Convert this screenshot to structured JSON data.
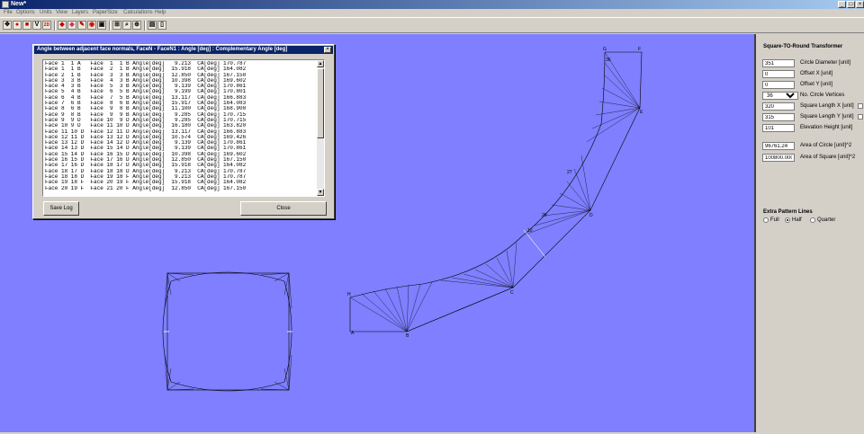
{
  "window": {
    "title": "New*",
    "minimize": "_",
    "maximize": "□",
    "close": "×"
  },
  "menu": [
    "File",
    "Options",
    "Units",
    "View",
    "Layers",
    "PaperSize",
    "Calculations",
    "Help"
  ],
  "toolbar": {
    "buttons": [
      {
        "name": "move-icon",
        "glyph": "✥"
      },
      {
        "name": "ring-icon",
        "glyph": "●"
      },
      {
        "name": "box-icon",
        "glyph": "■"
      },
      {
        "name": "v-icon",
        "glyph": "V"
      },
      {
        "name": "2d-icon",
        "glyph": "2D"
      },
      {
        "name": "shape-red-icon",
        "glyph": "◆"
      },
      {
        "name": "shape-pink-icon",
        "glyph": "◆"
      },
      {
        "name": "pen-icon",
        "glyph": "✎"
      },
      {
        "name": "stamp-icon",
        "glyph": "◉"
      },
      {
        "name": "print-icon",
        "glyph": "▣"
      },
      {
        "name": "measure-icon",
        "glyph": "⊞"
      },
      {
        "name": "zoom-icon",
        "glyph": "⌕"
      },
      {
        "name": "pan-icon",
        "glyph": "⊕"
      },
      {
        "name": "printer-icon",
        "glyph": "▤"
      },
      {
        "name": "page-icon",
        "glyph": "▯"
      }
    ]
  },
  "panel": {
    "title": "Square-TO-Round Transformer",
    "rows": [
      {
        "value": "351",
        "label": "Circle Diameter [unit]"
      },
      {
        "value": "0",
        "label": "Offset X [unit]"
      },
      {
        "value": "0",
        "label": "Offset Y [unit]"
      },
      {
        "value": "36",
        "label": "No. Circle Vertices",
        "type": "select"
      },
      {
        "value": "320",
        "label": "Square Length X [unit]",
        "check": true
      },
      {
        "value": "315",
        "label": "Square Length Y [unit]",
        "check": true
      },
      {
        "value": "101",
        "label": "Elevation Height [unit]"
      }
    ],
    "areas": [
      {
        "value": "96761.24",
        "label": "Area of Circle [unit]^2"
      },
      {
        "value": "100800.000",
        "label": "Area of Square [unit]^2"
      }
    ],
    "extra_title": "Extra Pattern Lines",
    "radios": [
      {
        "label": "Full",
        "selected": false
      },
      {
        "label": "Half",
        "selected": true
      },
      {
        "label": "Quarter",
        "selected": false
      }
    ]
  },
  "dialog": {
    "title": "Angle between adjacent face normals, FaceN - FaceN1 : Angle [deg] : Complementary Angle [deg]",
    "close_x": "×",
    "lines": [
      "Face 1  1 A   Face  1  1 B Angle[deg]   9.213  CA[deg] 170.787",
      "Face 1  1 B   Face  2  1 B Angle[deg]  15.918  CA[deg] 164.082",
      "Face 2  1 B   Face  3  3 B Angle[deg]  12.850  CA[deg] 167.150",
      "Face 3  3 B   Face  4  3 B Angle[deg]  10.398  CA[deg] 169.602",
      "Face 4  3 B   Face  5  3 B Angle[deg]   9.139  CA[deg] 170.861",
      "Face 5  4 B   Face  6  5 B Angle[deg]   9.199  CA[deg] 170.801",
      "Face 6  4 B   Face  7  5 B Angle[deg]  13.117  CA[deg] 166.883",
      "Face 7  6 B   Face  8  6 B Angle[deg]  15.917  CA[deg] 164.083",
      "Face 8  6 B   Face  9  8 B Angle[deg]  11.100  CA[deg] 168.900",
      "Face 9  8 B   Face  9  9 B Angle[deg]   9.285  CA[deg] 170.715",
      "Face 9  9 D   Face 10  9 D Angle[deg]   9.285  CA[deg] 170.715",
      "Face 10 9 D   Face 11 10 D Angle[deg]  16.180  CA[deg] 163.820",
      "Face 11 10 D  Face 12 11 D Angle[deg]  13.117  CA[deg] 166.883",
      "Face 12 11 D  Face 13 12 D Angle[deg]  10.574  CA[deg] 169.426",
      "Face 13 12 D  Face 14 12 D Angle[deg]   9.139  CA[deg] 170.861",
      "Face 14 13 D  Face 15 14 D Angle[deg]   9.139  CA[deg] 170.861",
      "Face 15 14 D  Face 16 15 D Angle[deg]  10.398  CA[deg] 169.602",
      "Face 16 15 D  Face 17 16 D Angle[deg]  12.850  CA[deg] 167.150",
      "Face 17 16 D  Face 18 17 D Angle[deg]  15.918  CA[deg] 164.082",
      "Face 18 17 D  Face 18 18 D Angle[deg]   9.213  CA[deg] 170.787",
      "Face 18 18 D  Face 19 18 F Angle[deg]   9.213  CA[deg] 170.787",
      "Face 19 18 F  Face 20 19 F Angle[deg]  15.918  CA[deg] 164.082",
      "Face 20 19 F  Face 21 20 F Angle[deg]  12.850  CA[deg] 167.150"
    ],
    "save_label": "Save Log",
    "close_label": "Close"
  },
  "drawing": {
    "pattern_labels": [
      "A",
      "B",
      "C",
      "D",
      "E",
      "F",
      "G",
      "H",
      "10",
      "20",
      "27",
      "36"
    ],
    "line_color": "#000000",
    "background_color": "#7f7fff"
  }
}
